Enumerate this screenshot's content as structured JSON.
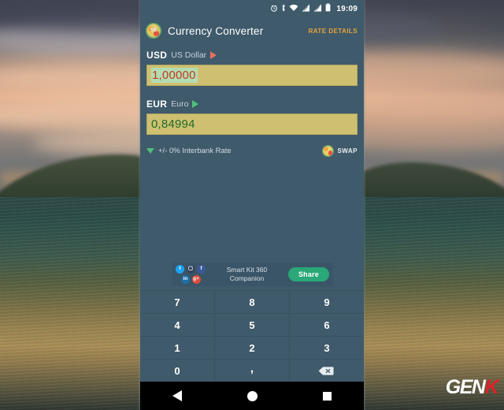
{
  "statusbar": {
    "time": "19:09",
    "icons": [
      "alarm-icon",
      "bluetooth-icon",
      "wifi-icon",
      "signal-icon-1",
      "signal-icon-2",
      "battery-icon"
    ]
  },
  "app": {
    "title": "Currency Converter",
    "logo_icon": "currency-converter-logo-icon",
    "rate_details_label": "RATE DETAILS"
  },
  "converter": {
    "from": {
      "code": "USD",
      "name": "US Dollar",
      "amount": "1,00000",
      "selector_icon": "triangle-right-icon"
    },
    "to": {
      "code": "EUR",
      "name": "Euro",
      "amount": "0,84994",
      "selector_icon": "triangle-right-icon"
    },
    "rate_note": "+/- 0% Interbank Rate",
    "rate_toggle_icon": "triangle-down-icon",
    "swap_label": "SWAP",
    "swap_icon": "swap-currency-icon"
  },
  "share_card": {
    "title_line1": "Smart Kit 360",
    "title_line2": "Companion",
    "share_button": "Share",
    "socials": [
      {
        "name": "twitter",
        "glyph": "t"
      },
      {
        "name": "instagram",
        "glyph": "▢"
      },
      {
        "name": "facebook",
        "glyph": "f"
      },
      {
        "name": "linkedin",
        "glyph": "in"
      },
      {
        "name": "googleplus",
        "glyph": "g+"
      }
    ]
  },
  "keypad": {
    "keys": [
      "7",
      "8",
      "9",
      "4",
      "5",
      "6",
      "1",
      "2",
      "3",
      "0",
      ","
    ],
    "backspace_icon": "backspace-icon"
  },
  "navbar": {
    "back_icon": "nav-back-icon",
    "home_icon": "nav-home-icon",
    "recents_icon": "nav-recents-icon"
  },
  "watermark": {
    "part1": "GEN",
    "part2": "K"
  },
  "colors": {
    "app_bg": "#3f5a6b",
    "field_bg": "#cfc071",
    "accent_orange": "#e8a33a",
    "accent_green": "#4ec17a",
    "from_value": "#c23a1e",
    "to_value": "#1f6b28",
    "share_button": "#2aa877"
  }
}
